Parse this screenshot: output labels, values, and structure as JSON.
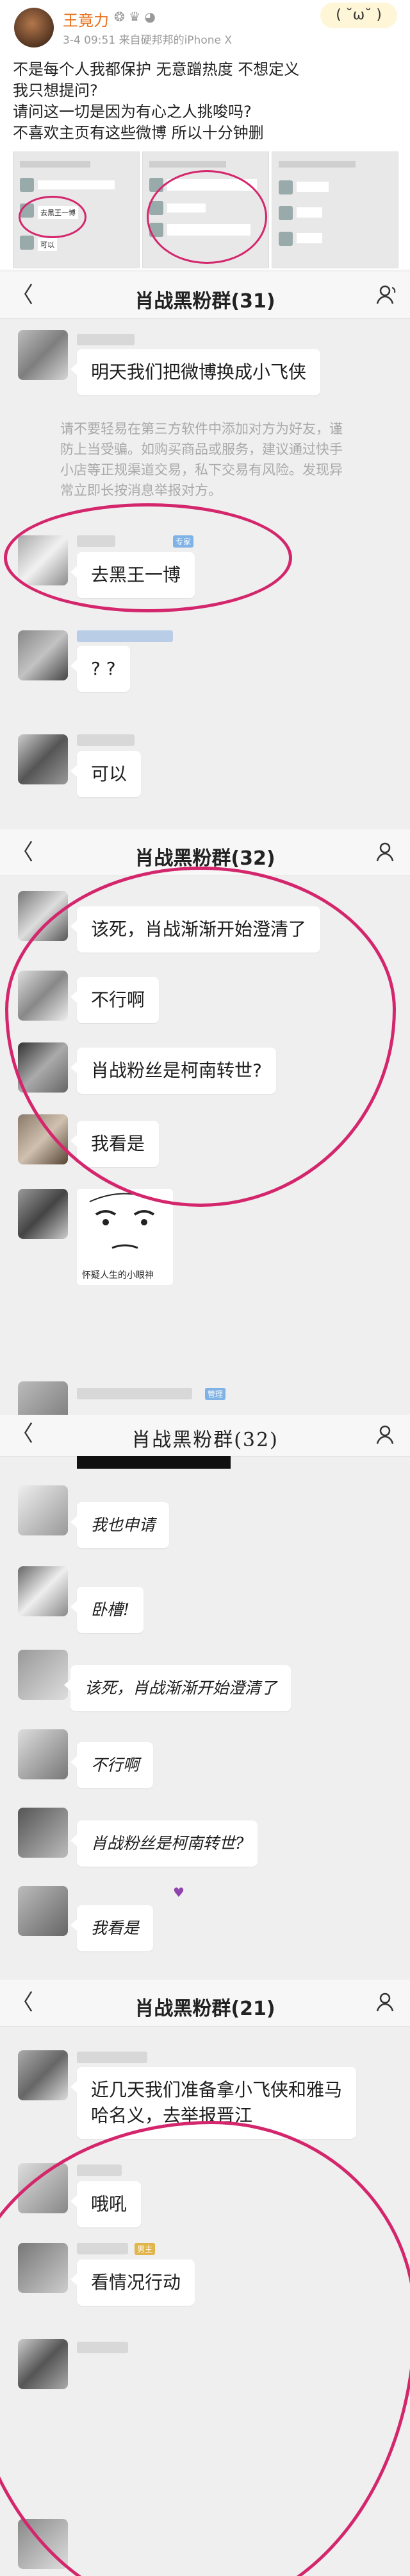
{
  "post": {
    "author": "王竟力",
    "meta": "3-4 09:51 来自硬邦邦的iPhone X",
    "lines": [
      "不是每个人我都保护 无意蹭热度 不想定义",
      "我只想提问?",
      "请问这一切是因为有心之人挑唆吗?",
      "不喜欢主页有这些微博 所以十分钟删"
    ],
    "thumb_captions": [
      "去黑王一博",
      "可以"
    ]
  },
  "panel1": {
    "title": "肖战黑粉群(31)",
    "messages": [
      "明天我们把微博换成小飞侠",
      "去黑王一博",
      "? ?",
      "可以"
    ],
    "system_notice": "请不要轻易在第三方软件中添加对方为好友，谨防上当受骗。如购买商品或服务，建议通过快手小店等正规渠道交易，私下交易有风险。发现异常立即长按消息举报对方。"
  },
  "panel2": {
    "title": "肖战黑粉群(32)",
    "messages": [
      "该死，肖战渐渐开始澄清了",
      "不行啊",
      "肖战粉丝是柯南转世?",
      "我看是"
    ],
    "sticker_caption": "怀疑人生的小眼神"
  },
  "panel3": {
    "title": "肖战黑粉群(32)",
    "messages": [
      "我也申请",
      "卧槽!",
      "该死，肖战渐渐开始澄清了",
      "不行啊",
      "肖战粉丝是柯南转世?",
      "我看是"
    ]
  },
  "panel4": {
    "title": "肖战黑粉群(21)",
    "messages": [
      "近几天我们准备拿小飞侠和雅马\n哈名义，去举报晋江",
      "哦吼",
      "看情况行动"
    ]
  },
  "colors": {
    "circle": "#d4266c",
    "bubble": "#ffffff",
    "navbar": "#f7f7f7"
  }
}
